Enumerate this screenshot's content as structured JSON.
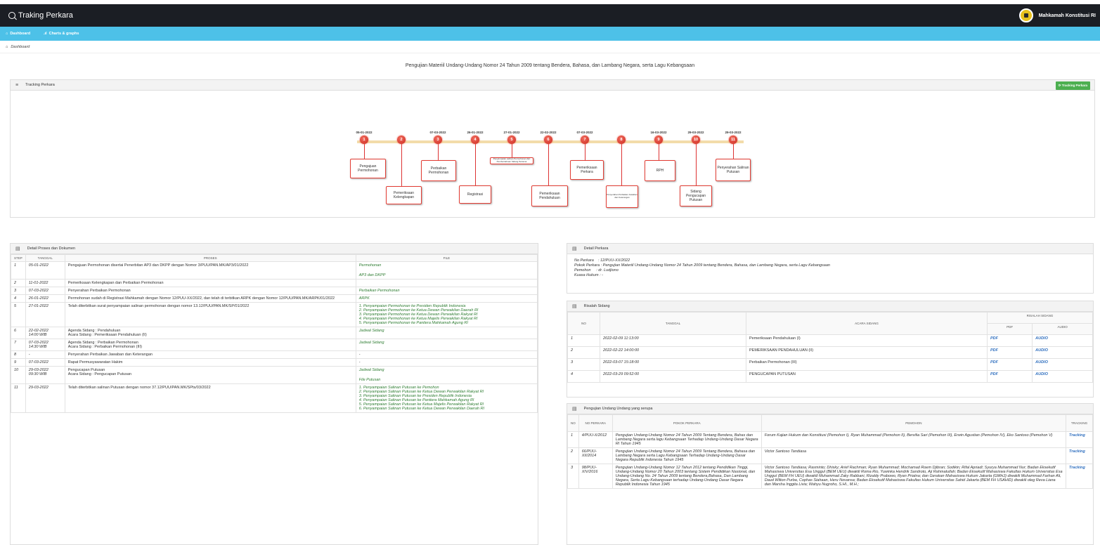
{
  "app": {
    "title": "Traking Perkara",
    "brand": "Mahkamah Konstitusi RI"
  },
  "nav": {
    "dashboard": "Dashboard",
    "charts": "Charts & graphs"
  },
  "breadcrumb": "Dashboard",
  "page_title": "Pengujian Materiil Undang-Undang Nomor 24 Tahun 2009 tentang Bendera, Bahasa, dan Lambang Negara, serta Lagu Kebangsaan",
  "tracking": {
    "header": "Tracking Perkara",
    "button": "Tracking Perkara",
    "nodes": [
      {
        "n": "1",
        "date": "05-01-2022",
        "label": "Pengajuan Permohonan"
      },
      {
        "n": "2",
        "date": "",
        "label": "Pemeriksaan Kelengkapan"
      },
      {
        "n": "3",
        "date": "07-03-2022",
        "label": "Perbaikan Permohonan"
      },
      {
        "n": "4",
        "date": "26-01-2022",
        "label": "Registrasi"
      },
      {
        "n": "5",
        "date": "27-01-2022",
        "label": "Penyampaian salinan Permohonan dan Pemberitahuan Sidang Pertama"
      },
      {
        "n": "6",
        "date": "22-02-2022",
        "label": "Pemeriksaan Pendahuluan"
      },
      {
        "n": "7",
        "date": "07-03-2022",
        "label": "Pemeriksaan Perkara"
      },
      {
        "n": "8",
        "date": "",
        "label": "Penyerahan Perbaikan Jawaban dan Keterangan"
      },
      {
        "n": "9",
        "date": "16-03-2022",
        "label": "RPH"
      },
      {
        "n": "10",
        "date": "29-03-2022",
        "label": "Sidang Pengucapan Putusan"
      },
      {
        "n": "11",
        "date": "29-03-2022",
        "label": "Penyerahan Salinan Putusan"
      }
    ]
  },
  "detail_proses": {
    "header": "Detail Proses dan Dokumen",
    "cols": [
      "STEP",
      "TANGGAL",
      "PROSES",
      "FILE"
    ],
    "rows": [
      {
        "step": "1",
        "date": "05-01-2022",
        "proses": "Pengajuan Permohonan disertai Penerbitan AP3 dan DKPP dengan Nomor 3/PUU/PAN.MK/AP3/01/2022",
        "files": [
          "Permohonan",
          "AP3 dan DKPP"
        ]
      },
      {
        "step": "2",
        "date": "11-01-2022",
        "proses": "Pemeriksaan Kelengkapan dan Perbaikan Permohonan",
        "files": []
      },
      {
        "step": "3",
        "date": "07-03-2022",
        "proses": "Penyerahan Perbaikan Permohonan",
        "files": [
          "Perbaikan Permohonan"
        ]
      },
      {
        "step": "4",
        "date": "26-01-2022",
        "proses": "Permohonan sudah di Registrasi Mahkamah dengan Nomor 12/PUU-XX/2022, dan telah di terbitkan ARPK dengan Nomor 12/PUU/PAN.MK/ARPK/01/2022",
        "files": [
          "ARPK"
        ]
      },
      {
        "step": "5",
        "date": "27-01-2022",
        "proses": "Telah diterbitkan surat penyampaian salinan permohonan dengan nomor 13.12/PUU/PAN.MK/SP/01/2022",
        "files": [
          "1. Penyampaian Permohonan ke Presiden Republik Indonesia",
          "2. Penyampaian Permohonan ke Ketua Dewan Perwakilan Daerah RI",
          "3. Penyampaian Permohonan ke Ketua Dewan Perwakilan Rakyat RI",
          "4. Penyampaian Permohonan ke Ketua Majelis Perwakilan Rakyat RI",
          "5. Penyampaian Permohonan ke Panitera Mahkamah Agung RI"
        ]
      },
      {
        "step": "6",
        "date": "22-02-2022\n14:00 WIB",
        "proses": "Agenda Sidang : Pendahuluan\nAcara Sidang : Pemeriksaan Pendahuluan (II)",
        "files": [
          "Jadwal Sidang"
        ]
      },
      {
        "step": "7",
        "date": "07-03-2022\n14:30 WIB",
        "proses": "Agenda Sidang : Perbaikan Permohonan\nAcara Sidang : Perbaikan Permohonan (III)",
        "files": [
          "Jadwal Sidang"
        ]
      },
      {
        "step": "8",
        "date": "-",
        "proses": "Penyerahan Perbaikan Jawaban dan Keterangan",
        "files": [
          "-"
        ]
      },
      {
        "step": "9",
        "date": "07-03-2022",
        "proses": "Rapat Permusyawaratan Hakim",
        "files": [
          "-"
        ]
      },
      {
        "step": "10",
        "date": "29-03-2022\n09:30 WIB",
        "proses": "Pengucapan Putusan\nAcara Sidang : Pengucapan Putusan",
        "files": [
          "Jadwal Sidang",
          "File Putusan"
        ]
      },
      {
        "step": "11",
        "date": "29-03-2022",
        "proses": "Telah diterbitkan salinan Putusan dengan nomor 37.12/PUU/PAN.MK/SPts/03/2022",
        "files": [
          "1. Penyampaian Salinan Putusan ke Pemohon",
          "2. Penyampaian Salinan Putusan ke Ketua Dewan Perwakilan Rakyat RI",
          "3. Penyampaian Salinan Putusan ke Presiden Republik Indonesia",
          "4. Penyampaian Salinan Putusan ke Panitera Mahkamah Agung RI",
          "5. Penyampaian Salinan Putusan ke Ketua Majelis Perwakilan Rakyat RI",
          "6. Penyampaian Salinan Putusan ke Ketua Dewan Perwakilan Daerah RI"
        ]
      }
    ]
  },
  "detail_perkara": {
    "header": "Detail Perkara",
    "lines": [
      "No Perkara    : 12/PUU-XX/2022",
      "Pokok Perkara : Pengujian Materiil Undang-Undang Nomor 24 Tahun 2009 tentang Bendera, Bahasa, dan Lambang Negara, serta Lagu Kebangsaan",
      "Pemohon     : dr. Ludjiono",
      "Kuasa Hukum : -"
    ]
  },
  "risalah": {
    "header": "Risalah Sidang",
    "group": "RISALAH SIDANG",
    "cols": [
      "NO",
      "TANGGAL",
      "ACARA SIDANG",
      "PDF",
      "AUDIO"
    ],
    "rows": [
      {
        "no": "1",
        "date": "2022-02-09 11:13:00",
        "acara": "Pemeriksaan Pendahuluan (I)",
        "pdf": "PDF",
        "audio": "AUDIO"
      },
      {
        "no": "2",
        "date": "2022-02-22 14:00:00",
        "acara": "PEMERIKSAAN PENDAHULUAN (II)",
        "pdf": "PDF",
        "audio": "AUDIO"
      },
      {
        "no": "3",
        "date": "2022-03-07 15:18:00",
        "acara": "Perbaikan Permohonan (III)",
        "pdf": "PDF",
        "audio": "AUDIO"
      },
      {
        "no": "4",
        "date": "2022-03-29 09:52:00",
        "acara": "PENGUCAPAN PUTUSAN",
        "pdf": "PDF",
        "audio": "AUDIO"
      }
    ]
  },
  "serupa": {
    "header": "Pengujian Undang Undang yang serupa",
    "cols": [
      "NO",
      "NO PERKARA",
      "POKOK PERKARA",
      "PEMOHON",
      "TRACKING"
    ],
    "rows": [
      {
        "no": "1",
        "perkara": "4/PUU-X/2012",
        "pokok": "Pengujian Undang-Undang Nomor 24 Tahun 2009 Tentang Bendera, Bahas dan Lambang Negara serta lagu Kebangsaan Terhadap Undang-Undang Dasar Negara RI Tahun 1945",
        "pemohon": "Forum Kajian Hukum dan Konstitusi (Pemohon I), Ryan Muhammad (Pemohon II), Bervilia Sari (Pemohon III), Erwin Agustian (Pemohon IV), Eko Santoso (Pemohon V)",
        "tracking": "Tracking"
      },
      {
        "no": "2",
        "perkara": "66/PUU-XII/2014",
        "pokok": "Pengujian Undang-Undang Nomor 24 Tahun 2009 Tentang Bendera, Bahasa dan Lambang Negara serta Lagu Kebangsaan Terhadap Undang-Undang Dasar Negara Republik Indonesia Tahun 1945",
        "pemohon": "Victor Santoso Tandiasa",
        "tracking": "Tracking"
      },
      {
        "no": "3",
        "perkara": "98/PUU-XIV/2016",
        "pokok": "Pengujian Undang-Undang Nomor 12 Tahun 2012 tentang Pendidikan Tinggi, Undang-Undang Nomor 20 Tahun 2003 tentang Sistem Pendidikan Nasional, dan Undang-Undang No. 24 Tahun 2009 tentang Bendera,Bahasa, Dan Lambang Negara, Serta Lagu Kebangsaan terhadap Undang-Undang Dasar Negara Republik Indonesia Tahun 1945",
        "pemohon": "Victor Santoso Tandiasa; Rasminto; Dhisky; Arief Rachman; Ryan Muhammad; Mochamad Roem Djibran; Sodikin; Rifal Apriadi; Syurya Muhammad Nur; Badan Eksekutif Mahasiswa Universitas Esa Unggul (BEM UEU) diwakili Roma Rio, Yuwinka Hendrik Sandroto, Aji Rahmatullah; Badan Eksekutif Mahasiswa Fakultas Hukum Universitas Esa Unggul (BEM FH UEU) diwakili Muhammad Zaky Rabbani, Rizaldy Prabowo, Ryan Priatna; dan Gerakan Mahasiswa Hukum Jakarta (GMHJ) diwakili Muhammad Farhan Ali, Daud Wilton Purba, Cophas Siahaan, Heru Novansa; Badan Eksekutif Mahasiswa Fakultas Hukum Universitas Sahid Jakarta (BEM FH USAHID) diwakili oleg Reva Liana dan Marsha Inggita Livia; Wahyu Nugroho, S.HI., M.H.;",
        "tracking": "Tracking"
      }
    ]
  }
}
